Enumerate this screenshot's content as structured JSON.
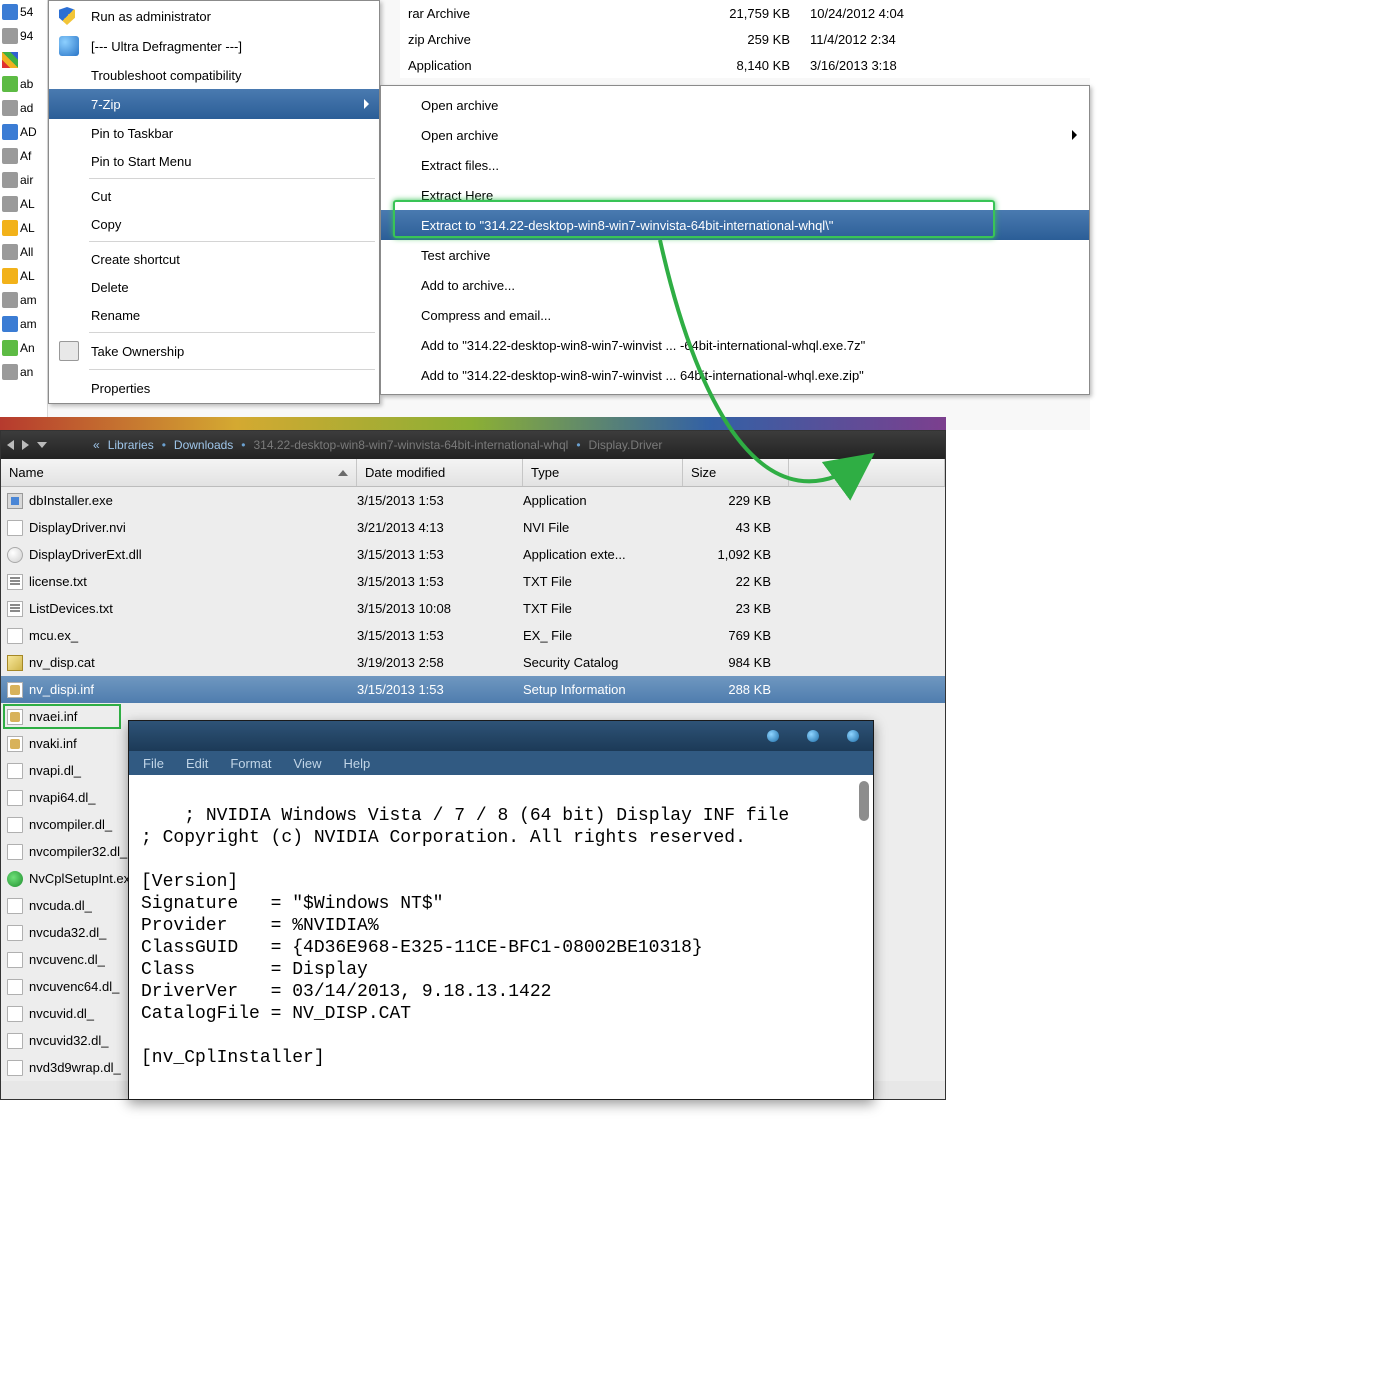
{
  "upper_sidebar": [
    {
      "icon": "blue",
      "label": "54"
    },
    {
      "icon": "gray",
      "label": "94"
    },
    {
      "icon": "rainbow",
      "label": ""
    },
    {
      "icon": "green",
      "label": "ab"
    },
    {
      "icon": "gray",
      "label": "ad"
    },
    {
      "icon": "blue",
      "label": "AD"
    },
    {
      "icon": "gray",
      "label": "Af"
    },
    {
      "icon": "gray",
      "label": "air"
    },
    {
      "icon": "gray",
      "label": "AL"
    },
    {
      "icon": "orange",
      "label": "AL"
    },
    {
      "icon": "gray",
      "label": "All"
    },
    {
      "icon": "orange",
      "label": "AL"
    },
    {
      "icon": "gray",
      "label": "am"
    },
    {
      "icon": "blue",
      "label": "am"
    },
    {
      "icon": "green",
      "label": "An"
    },
    {
      "icon": "gray",
      "label": "an"
    }
  ],
  "upper_rows": [
    {
      "type": "rar Archive",
      "size": "21,759 KB",
      "date": "10/24/2012 4:04"
    },
    {
      "type": "zip Archive",
      "size": "259 KB",
      "date": "11/4/2012 2:34"
    },
    {
      "type": "Application",
      "size": "8,140 KB",
      "date": "3/16/2013 3:18"
    }
  ],
  "ctx": {
    "run_admin": "Run as administrator",
    "ultra": "[--- Ultra Defragmenter ---]",
    "troubleshoot": "Troubleshoot compatibility",
    "sevenzip": "7-Zip",
    "pin_taskbar": "Pin to Taskbar",
    "pin_start": "Pin to Start Menu",
    "cut": "Cut",
    "copy": "Copy",
    "shortcut": "Create shortcut",
    "delete": "Delete",
    "rename": "Rename",
    "ownership": "Take Ownership",
    "properties": "Properties"
  },
  "submenu": {
    "open1": "Open archive",
    "open2": "Open archive",
    "extract_files": "Extract files...",
    "extract_here": "Extract Here",
    "extract_to": "Extract to \"314.22-desktop-win8-win7-winvista-64bit-international-whql\\\"",
    "test": "Test archive",
    "add": "Add to archive...",
    "compress": "Compress and email...",
    "add_7z": "Add to \"314.22-desktop-win8-win7-winvist ... -64bit-international-whql.exe.7z\"",
    "add_zip": "Add to \"314.22-desktop-win8-win7-winvist ... 64bit-international-whql.exe.zip\""
  },
  "breadcrumb": {
    "b1": "Libraries",
    "b2": "Downloads",
    "b3": "314.22-desktop-win8-win7-winvista-64bit-international-whql",
    "b4": "Display.Driver"
  },
  "cols": {
    "name": "Name",
    "date": "Date modified",
    "type": "Type",
    "size": "Size"
  },
  "files": [
    {
      "icon": "exe",
      "name": "dbInstaller.exe",
      "date": "3/15/2013 1:53",
      "type": "Application",
      "size": "229 KB"
    },
    {
      "icon": "page",
      "name": "DisplayDriver.nvi",
      "date": "3/21/2013 4:13",
      "type": "NVI File",
      "size": "43 KB"
    },
    {
      "icon": "dll",
      "name": "DisplayDriverExt.dll",
      "date": "3/15/2013 1:53",
      "type": "Application exte...",
      "size": "1,092 KB"
    },
    {
      "icon": "txt",
      "name": "license.txt",
      "date": "3/15/2013 1:53",
      "type": "TXT File",
      "size": "22 KB"
    },
    {
      "icon": "txt",
      "name": "ListDevices.txt",
      "date": "3/15/2013 10:08",
      "type": "TXT File",
      "size": "23 KB"
    },
    {
      "icon": "page",
      "name": "mcu.ex_",
      "date": "3/15/2013 1:53",
      "type": "EX_ File",
      "size": "769 KB"
    },
    {
      "icon": "cat",
      "name": "nv_disp.cat",
      "date": "3/19/2013 2:58",
      "type": "Security Catalog",
      "size": "984 KB"
    },
    {
      "icon": "inf",
      "name": "nv_dispi.inf",
      "date": "3/15/2013 1:53",
      "type": "Setup Information",
      "size": "288 KB",
      "selected": true
    },
    {
      "icon": "inf",
      "name": "nvaei.inf"
    },
    {
      "icon": "inf",
      "name": "nvaki.inf"
    },
    {
      "icon": "page",
      "name": "nvapi.dl_"
    },
    {
      "icon": "page",
      "name": "nvapi64.dl_"
    },
    {
      "icon": "page",
      "name": "nvcompiler.dl_"
    },
    {
      "icon": "page",
      "name": "nvcompiler32.dl_"
    },
    {
      "icon": "nvcpl",
      "name": "NvCplSetupInt.exe"
    },
    {
      "icon": "page",
      "name": "nvcuda.dl_"
    },
    {
      "icon": "page",
      "name": "nvcuda32.dl_"
    },
    {
      "icon": "page",
      "name": "nvcuvenc.dl_"
    },
    {
      "icon": "page",
      "name": "nvcuvenc64.dl_"
    },
    {
      "icon": "page",
      "name": "nvcuvid.dl_"
    },
    {
      "icon": "page",
      "name": "nvcuvid32.dl_"
    },
    {
      "icon": "page",
      "name": "nvd3d9wrap.dl_"
    }
  ],
  "notepad": {
    "menus": [
      "File",
      "Edit",
      "Format",
      "View",
      "Help"
    ],
    "content": "; NVIDIA Windows Vista / 7 / 8 (64 bit) Display INF file\n; Copyright (c) NVIDIA Corporation. All rights reserved.\n\n[Version]\nSignature   = \"$Windows NT$\"\nProvider    = %NVIDIA%\nClassGUID   = {4D36E968-E325-11CE-BFC1-08002BE10318}\nClass       = Display\nDriverVer   = 03/14/2013, 9.18.13.1422\nCatalogFile = NV_DISP.CAT\n\n[nv_CplInstaller]"
  }
}
